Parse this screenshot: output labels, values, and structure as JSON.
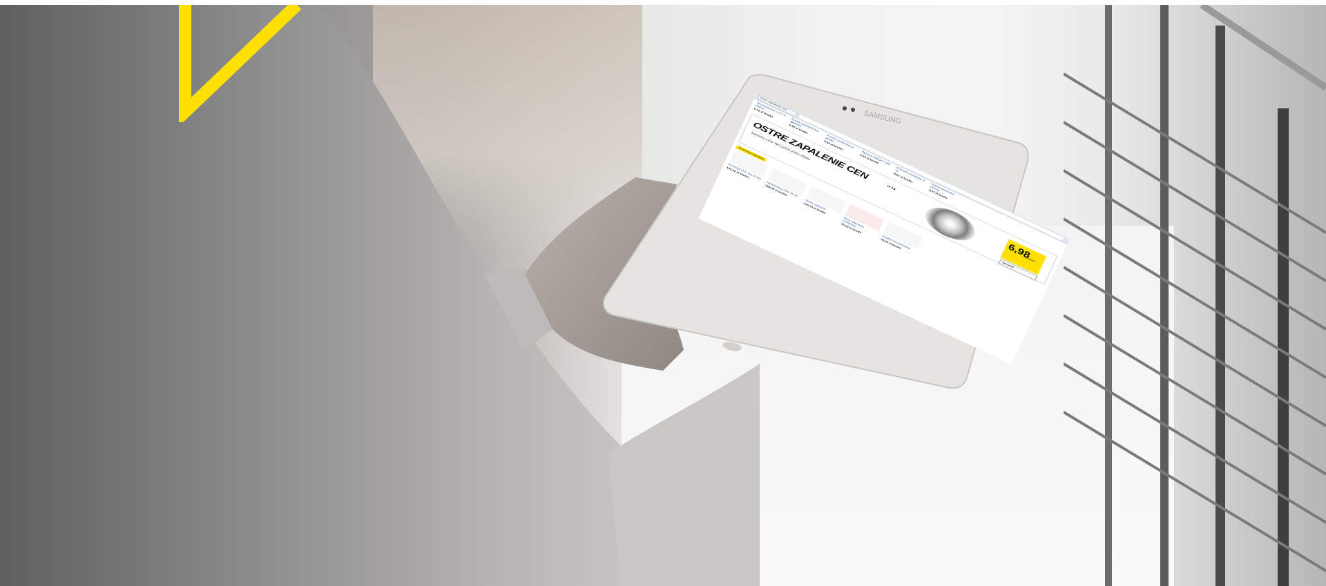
{
  "scene": {
    "description": "",
    "tablet_brand": "SAMSUNG",
    "colors": {
      "accent_yellow": "#ffe000"
    }
  },
  "screen": {
    "browser_tab": "Ostre zapalenie cen",
    "top_products": [
      {
        "name": "Akumulatorek 1,2 V 6 baterii",
        "price": "6,15 zł brutto"
      },
      {
        "name": "Puszka podtynkowa głęboka",
        "price": "6,19 zł brutto"
      },
      {
        "name": "Puszka podtynkowa płaska",
        "price": "5,94 zł brutto"
      },
      {
        "name": "Oprawa halogen LED",
        "price": "6,23 zł brutto"
      },
      {
        "name": "Przewód zasilający 5 m",
        "price": "8,61 zł brutto"
      },
      {
        "name": "Taśma izolacyjna czarna",
        "price": "3,07 zł brutto"
      }
    ],
    "banner": {
      "title": "OSTRE ZAPALENIE CEN",
      "week": "w 13",
      "subtitle": "Żarówka LED 3W GU10 230V 250lm",
      "price": "6,98",
      "price_label": "netto/szt.",
      "show_button": "Sprawdź"
    },
    "promo_strip": "Promocja tygodnia",
    "bottom_products": [
      {
        "name": "Przewód YDY 3x1,5 mm",
        "price": "101,42 zł brutto"
      },
      {
        "name": "Naświetlacz LED 30 W",
        "price": "159,29 zł brutto"
      },
      {
        "name": "Tester napięcia",
        "price": "216,75 zł brutto"
      },
      {
        "name": "Rura osłonowa czerwona",
        "price": "76,32 zł brutto"
      },
      {
        "name": "Puszka hermetyczna",
        "price": "33,50 zł brutto"
      }
    ]
  }
}
